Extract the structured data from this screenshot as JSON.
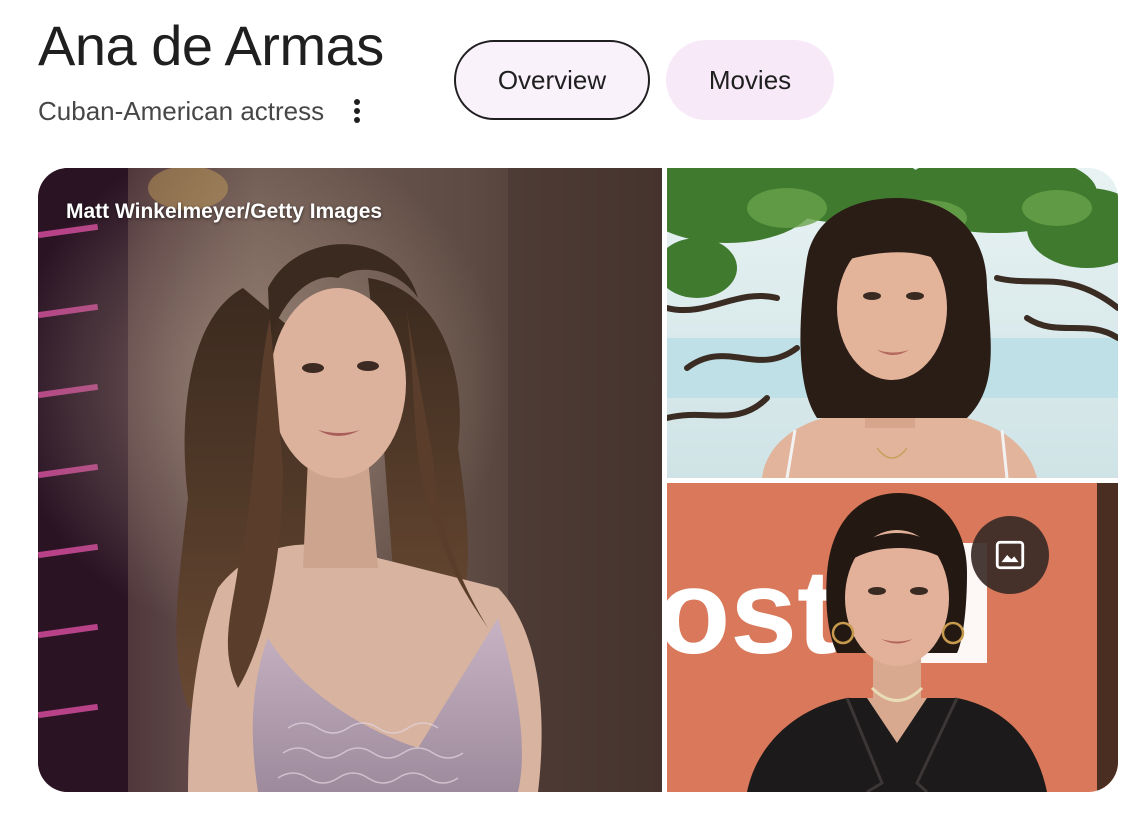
{
  "header": {
    "title": "Ana de Armas",
    "subtitle": "Cuban-American actress",
    "more_icon": "more-vert-icon"
  },
  "tabs": [
    {
      "label": "Overview",
      "selected": true
    },
    {
      "label": "Movies",
      "selected": false
    }
  ],
  "gallery": {
    "photos": [
      {
        "credit": "Matt Winkelmeyer/Getty Images",
        "subject": "woman with long wavy brown hair in lilac sequined dress"
      },
      {
        "subject": "woman with shoulder-length dark hair in front of tree branches"
      },
      {
        "subject": "woman with hair pulled back wearing black leather jacket and hoop earrings"
      }
    ],
    "partial_sign_text": "ost",
    "image_button_icon": "image-icon"
  },
  "colors": {
    "tab_selected_bg": "#faf2fb",
    "tab_bg": "#f7e9f8",
    "text_primary": "#1f1f1f",
    "text_secondary": "#474747"
  }
}
